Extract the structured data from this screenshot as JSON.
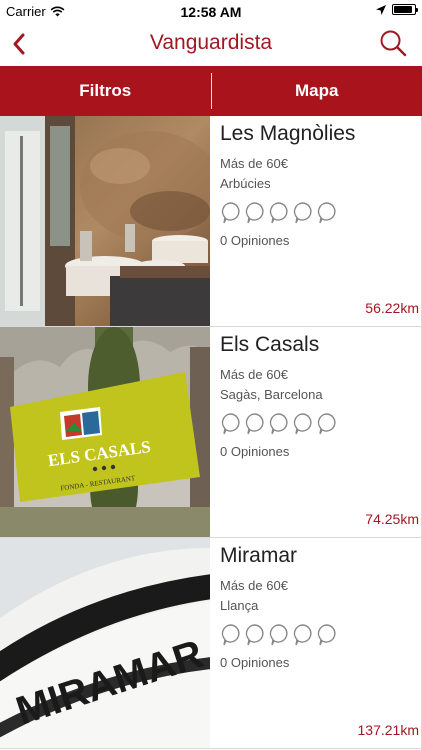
{
  "status": {
    "carrier": "Carrier",
    "time": "12:58 AM",
    "battery_level": 0.92
  },
  "nav": {
    "title": "Vanguardista",
    "back_icon": "chevron-left-icon",
    "search_icon": "search-icon"
  },
  "tabs": {
    "filters": "Filtros",
    "map": "Mapa"
  },
  "colors": {
    "brand": "#a8131c",
    "accent_text": "#a01822"
  },
  "restaurants": [
    {
      "name": "Les Magnòlies",
      "price": "Más de 60€",
      "location": "Arbúcies",
      "opinions": "0 Opiniones",
      "distance": "56.22km",
      "rating": 0,
      "rating_max": 5
    },
    {
      "name": "Els Casals",
      "price": "Más de 60€",
      "location": "Sagàs, Barcelona",
      "opinions": "0 Opiniones",
      "distance": "74.25km",
      "rating": 0,
      "rating_max": 5,
      "sign": {
        "line1": "ELS CASALS",
        "line2": "FONDA - RESTAURANT"
      }
    },
    {
      "name": "Miramar",
      "price": "Más de 60€",
      "location": "Llança",
      "opinions": "0 Opiniones",
      "distance": "137.21km",
      "rating": 0,
      "rating_max": 5,
      "sign": {
        "text": "MIRAMAR"
      }
    }
  ]
}
